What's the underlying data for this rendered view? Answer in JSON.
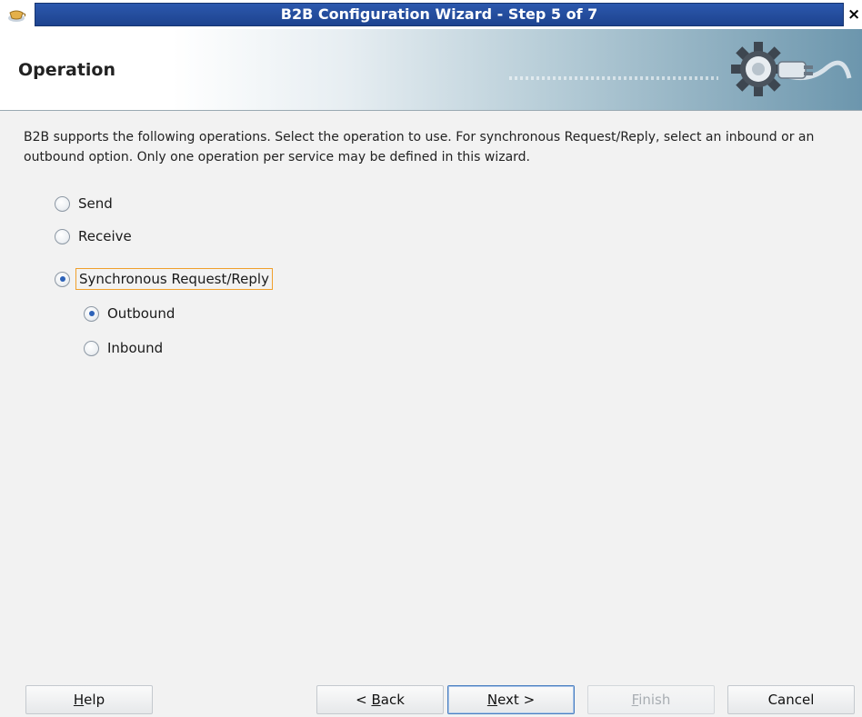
{
  "window": {
    "title": "B2B Configuration Wizard - Step 5 of 7",
    "close_glyph": "×"
  },
  "header": {
    "title": "Operation",
    "graphic_icon": "gear-plug-icon"
  },
  "description": "B2B supports the following operations.  Select the operation to use.  For synchronous Request/Reply, select an inbound or an outbound option. Only one operation per service may be defined in this wizard.",
  "operations": {
    "send": {
      "label": "Send",
      "checked": false
    },
    "receive": {
      "label": "Receive",
      "checked": false
    },
    "sync": {
      "label": "Synchronous Request/Reply",
      "checked": true
    },
    "outbound": {
      "label": "Outbound",
      "checked": true
    },
    "inbound": {
      "label": "Inbound",
      "checked": false
    }
  },
  "buttons": {
    "help": {
      "label": "Help",
      "mnemonic": "H",
      "rest": "elp"
    },
    "back": {
      "label": "< Back",
      "pre": "< ",
      "mnemonic": "B",
      "rest": "ack"
    },
    "next": {
      "label": "Next >",
      "mnemonic": "N",
      "rest": "ext >"
    },
    "finish": {
      "label": "Finish",
      "mnemonic": "F",
      "rest": "inish",
      "enabled": false
    },
    "cancel": {
      "label": "Cancel"
    }
  },
  "colors": {
    "title_bar": "#2c58ad",
    "radio_dot": "#2d62b8",
    "focus_border": "#f0a02c",
    "default_button_border": "#4a7fc1"
  }
}
